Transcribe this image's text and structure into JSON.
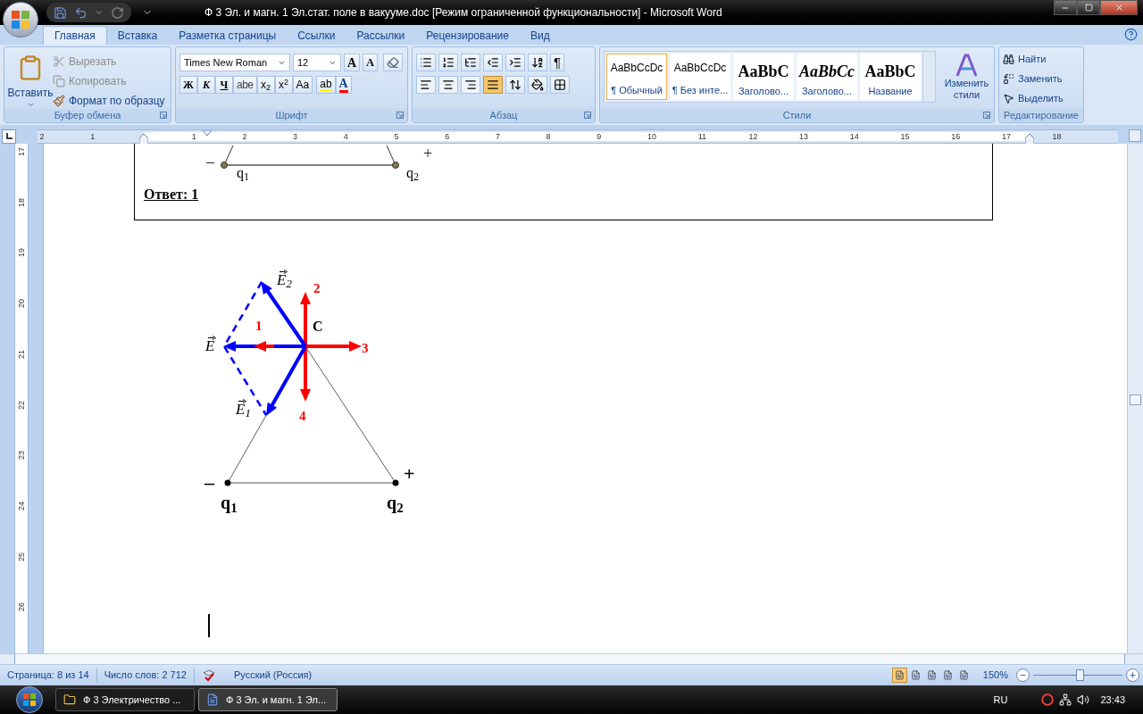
{
  "window": {
    "title": "Ф 3 Эл. и магн. 1 Эл.стат. поле в вакууме.doc [Режим ограниченной функциональности] - Microsoft Word"
  },
  "tabs": [
    {
      "label": "Главная",
      "selected": true
    },
    {
      "label": "Вставка",
      "selected": false
    },
    {
      "label": "Разметка страницы",
      "selected": false
    },
    {
      "label": "Ссылки",
      "selected": false
    },
    {
      "label": "Рассылки",
      "selected": false
    },
    {
      "label": "Рецензирование",
      "selected": false
    },
    {
      "label": "Вид",
      "selected": false
    }
  ],
  "clipboard": {
    "title": "Буфер обмена",
    "paste": "Вставить",
    "items": [
      {
        "label": "Вырезать",
        "disabled": true,
        "kind": "cut"
      },
      {
        "label": "Копировать",
        "disabled": true,
        "kind": "copy"
      },
      {
        "label": "Формат по образцу",
        "disabled": false,
        "kind": "format"
      }
    ]
  },
  "font": {
    "title": "Шрифт",
    "name": "Times New Roman",
    "size": "12",
    "grow": "A",
    "shrink": "A",
    "styles": [
      {
        "text": "Ж",
        "kind": "bold"
      },
      {
        "text": "К",
        "kind": "italic"
      },
      {
        "text": "Ч",
        "kind": "underline"
      },
      {
        "text": "abe",
        "kind": "strike"
      },
      {
        "text": "x$_{2}$",
        "kind": "plain"
      },
      {
        "text": "x$^{2}$",
        "kind": "plain"
      },
      {
        "text": "Aa",
        "kind": "plain"
      }
    ],
    "highlight": "ab",
    "color_letter": "A"
  },
  "paragraph": {
    "title": "Абзац",
    "pilcrow": "¶",
    "alignments": [
      {
        "kind": "left",
        "selected": false
      },
      {
        "kind": "center",
        "selected": false
      },
      {
        "kind": "right",
        "selected": false
      },
      {
        "kind": "justify",
        "selected": true
      }
    ]
  },
  "styles": {
    "title": "Стили",
    "change": "Изменить стили",
    "items": [
      {
        "preview": "AaBbCcDc",
        "name": "¶ Обычный",
        "kind": "plain",
        "selected": true
      },
      {
        "preview": "AaBbCcDc",
        "name": "¶ Без инте...",
        "kind": "plain",
        "selected": false
      },
      {
        "preview": "AaBbC",
        "name": "Заголово...",
        "kind": "heading",
        "selected": false
      },
      {
        "preview": "AaBbCc",
        "name": "Заголово...",
        "kind": "heading-italic",
        "selected": false
      },
      {
        "preview": "AaBbC",
        "name": "Название",
        "kind": "heading",
        "selected": false
      }
    ]
  },
  "editing": {
    "title": "Редактирование",
    "items": [
      {
        "label": "Найти",
        "kind": "find"
      },
      {
        "label": "Заменить",
        "kind": "replace"
      },
      {
        "label": "Выделить",
        "kind": "select"
      }
    ]
  },
  "ruler": {
    "labels": [
      "2",
      "1",
      "1",
      "2",
      "3",
      "4",
      "5",
      "6",
      "7",
      "8",
      "9",
      "10",
      "11",
      "12",
      "13",
      "14",
      "15",
      "16",
      "17",
      "18"
    ]
  },
  "vertical_ruler": {
    "labels": [
      "17",
      "18",
      "19",
      "20",
      "21",
      "22",
      "23",
      "24",
      "25",
      "26"
    ]
  },
  "document": {
    "box": {
      "answer": "Ответ: 1",
      "labels": [
        {
          "text": "–",
          "kind": "sign"
        },
        {
          "text": "+",
          "kind": "sign"
        },
        {
          "text": "q$_{1}$",
          "kind": "charge-light"
        },
        {
          "text": "q$_{2}$",
          "kind": "charge-light"
        }
      ]
    },
    "diagram": {
      "labels": [
        {
          "text": "E$_{2}$",
          "kind": "vector"
        },
        {
          "text": "2",
          "kind": "number"
        },
        {
          "text": "1",
          "kind": "number"
        },
        {
          "text": "C",
          "kind": "point"
        },
        {
          "text": "3",
          "kind": "number"
        },
        {
          "text": "E",
          "kind": "vector"
        },
        {
          "text": "E$_{1}$",
          "kind": "vector"
        },
        {
          "text": "4",
          "kind": "number"
        },
        {
          "text": "–",
          "kind": "sign-bold"
        },
        {
          "text": "+",
          "kind": "sign-bold"
        },
        {
          "text": "q$_{1}$",
          "kind": "charge"
        },
        {
          "text": "q$_{2}$",
          "kind": "charge"
        }
      ]
    }
  },
  "status_bar": {
    "page": "Страница: 8 из 14",
    "words": "Число слов: 2 712",
    "language": "Русский (Россия)",
    "views": [
      {
        "selected": true
      },
      {
        "selected": false
      },
      {
        "selected": false
      },
      {
        "selected": false
      },
      {
        "selected": false
      }
    ],
    "zoom": "150%",
    "zoom_slider": {
      "level": 0.52
    }
  },
  "taskbar": {
    "items": [
      {
        "label": "Ф 3 Электричество ...",
        "selected": false
      },
      {
        "label": "Ф 3 Эл. и магн. 1 Эл...",
        "selected": true
      }
    ],
    "language": "RU",
    "clock": "23:43"
  }
}
